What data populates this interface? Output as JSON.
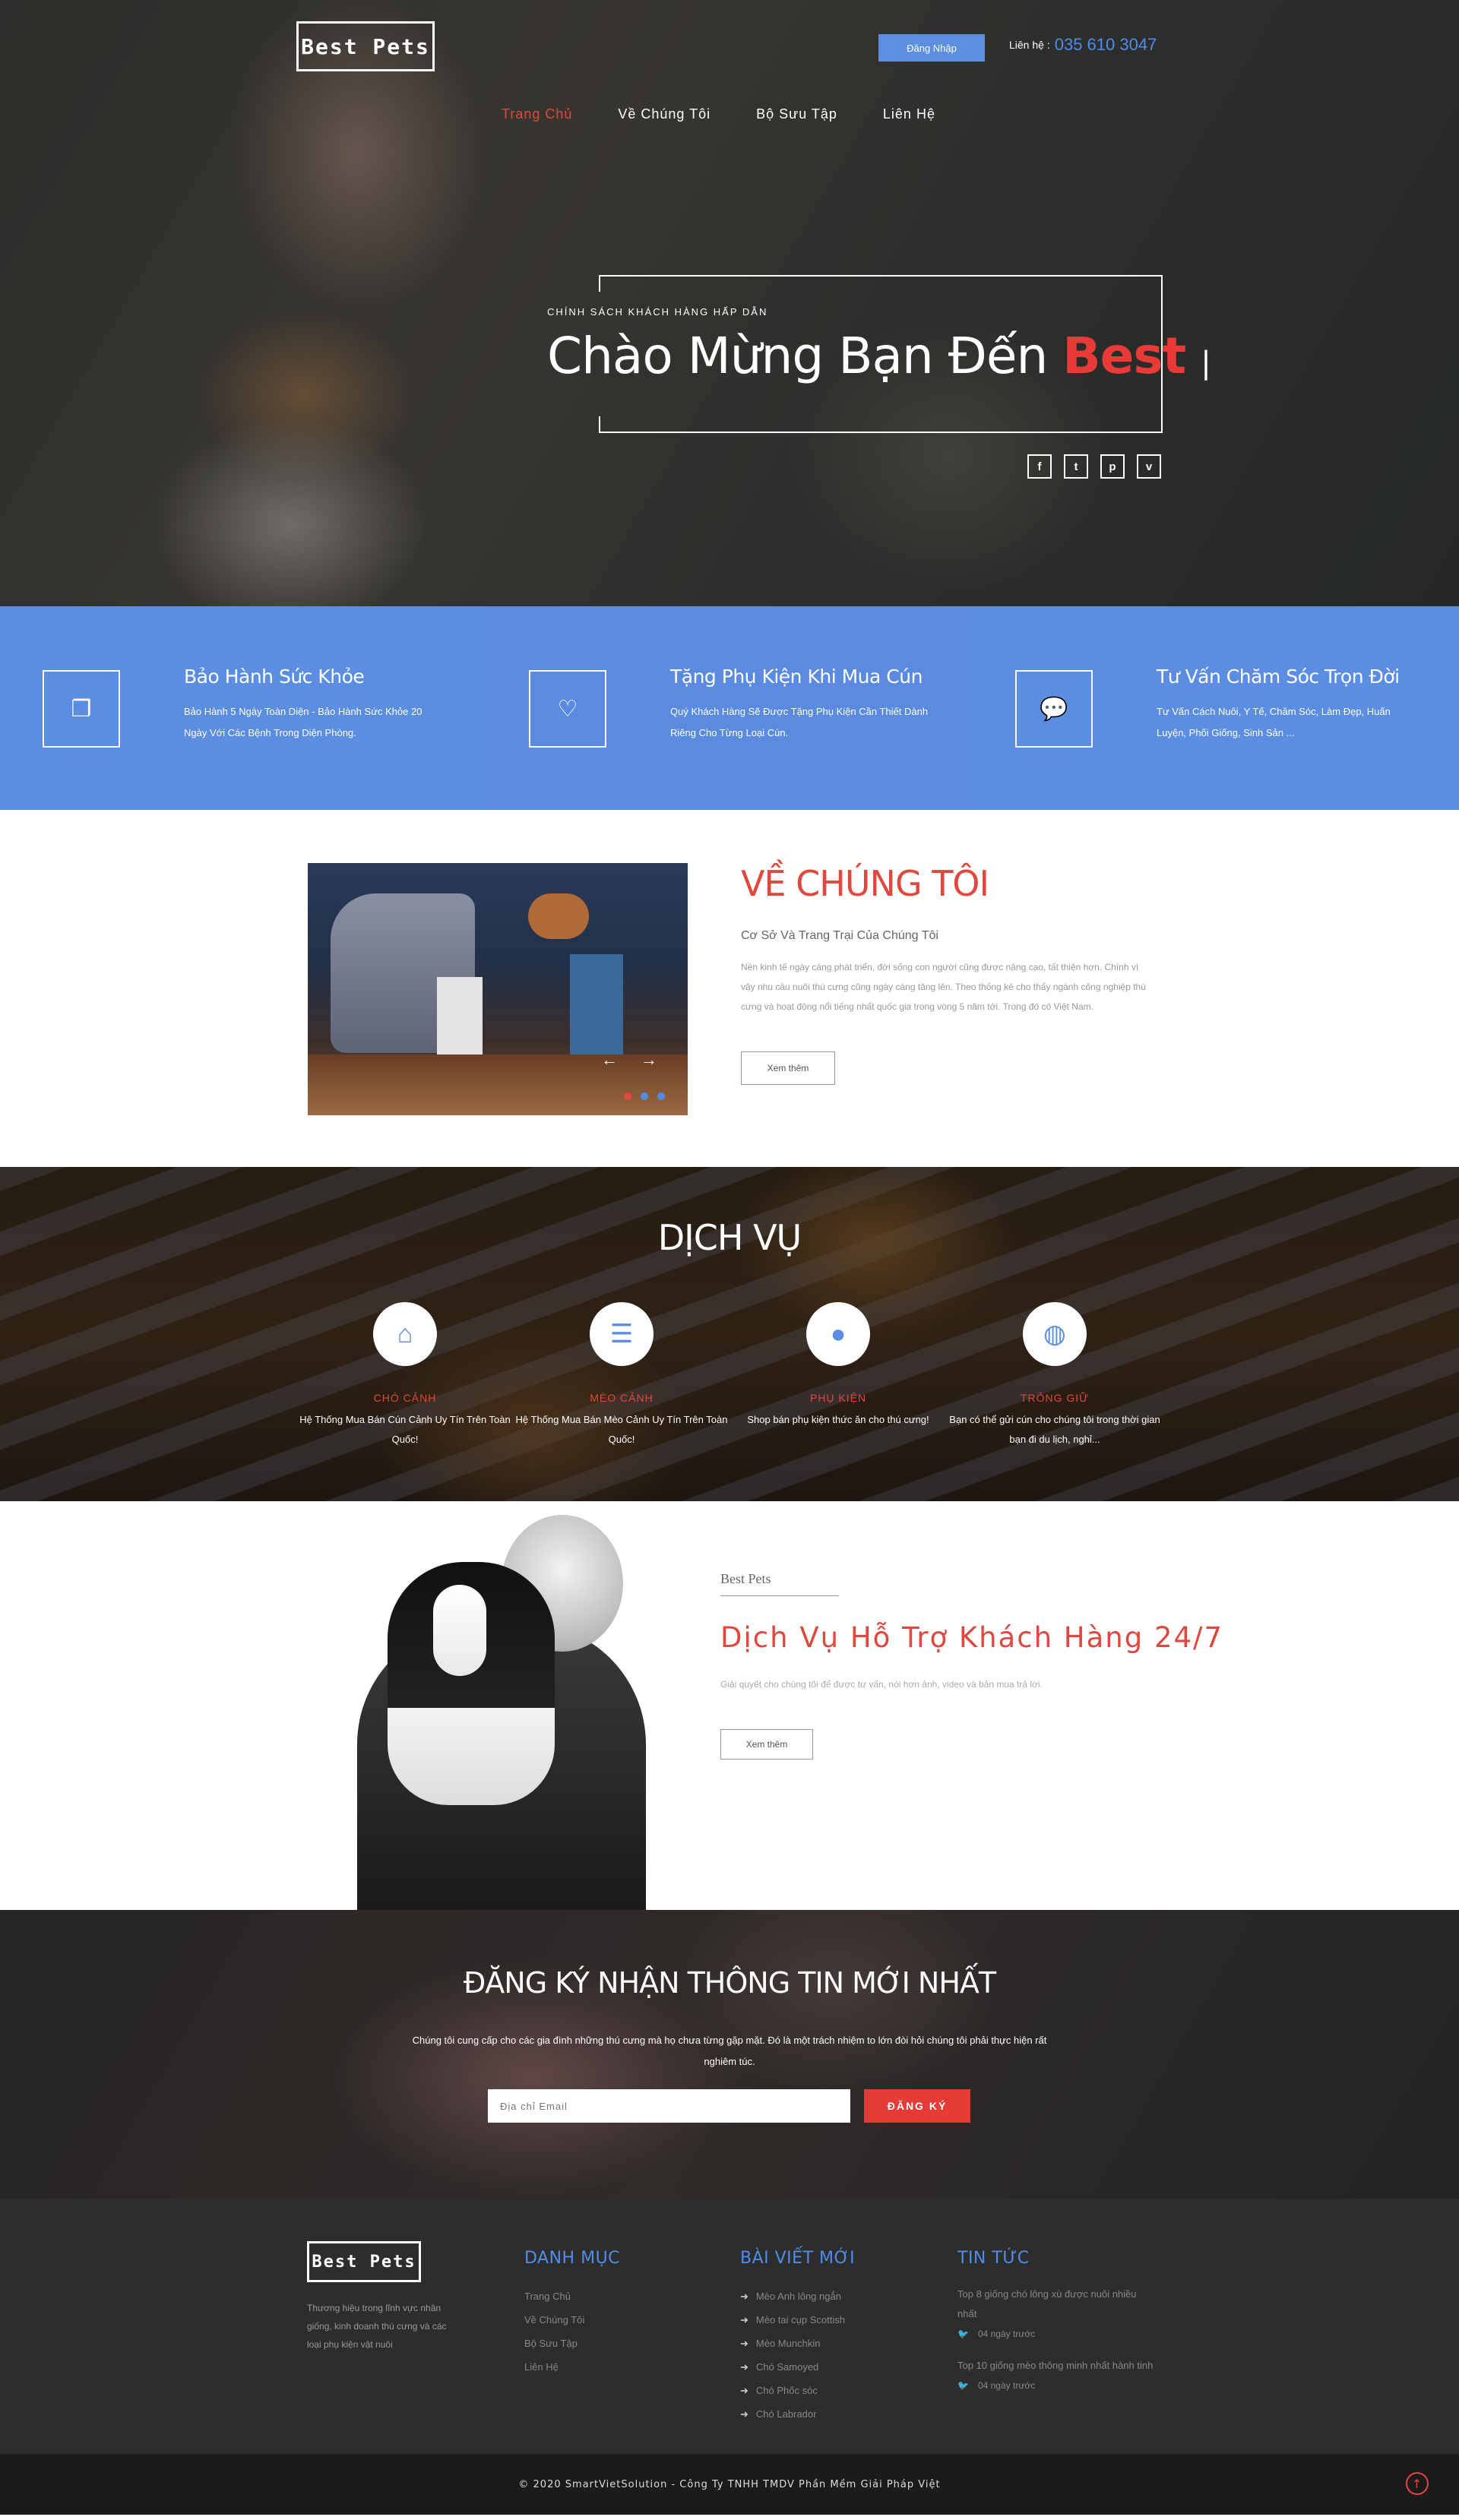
{
  "header": {
    "logo": "Best Pets",
    "login_label": "Đăng Nhập",
    "contact_label": "Liên hệ :",
    "phone": "035 610 3047",
    "nav": [
      {
        "label": "Trang Chủ",
        "active": true
      },
      {
        "label": "Về Chúng Tôi",
        "active": false
      },
      {
        "label": "Bộ Sưu Tập",
        "active": false
      },
      {
        "label": "Liên Hệ",
        "active": false
      }
    ]
  },
  "hero": {
    "kicker": "CHÍNH SÁCH KHÁCH HÀNG HẤP DẪN",
    "title_prefix": "Chào Mừng Bạn Đến",
    "title_highlight": "Best",
    "cursor": "|",
    "social": [
      {
        "icon": "facebook-icon",
        "glyph": "f"
      },
      {
        "icon": "twitter-icon",
        "glyph": "t"
      },
      {
        "icon": "pinterest-icon",
        "glyph": "p"
      },
      {
        "icon": "vimeo-icon",
        "glyph": "v"
      }
    ]
  },
  "features": [
    {
      "icon": "copy-icon",
      "glyph": "❐",
      "title": "Bảo Hành Sức Khỏe",
      "text": "Bảo Hành 5 Ngày Toàn Diện - Bảo Hành Sức Khỏe 20 Ngày Với Các Bệnh Trong Diện Phòng."
    },
    {
      "icon": "heart-icon",
      "glyph": "♡",
      "title": "Tặng Phụ Kiện Khi Mua Cún",
      "text": "Quý Khách Hàng Sẽ Được Tặng Phụ Kiện Cần Thiết Dành Riêng Cho Từng Loại Cún."
    },
    {
      "icon": "chat-icon",
      "glyph": "💬",
      "title": "Tư Vấn Chăm Sóc Trọn Đời",
      "text": "Tư Vấn Cách Nuôi, Y Tế, Chăm Sóc, Làm Đẹp, Huấn Luyện, Phối Giống, Sinh Sản ..."
    }
  ],
  "about": {
    "title": "VỀ CHÚNG TÔI",
    "subtitle": "Cơ Sở Và Trang Trại Của Chúng Tôi",
    "text": "Nền kinh tế ngày càng phát triển, đời sống con người cũng được nâng cao, tất thiện hơn. Chính vì vậy nhu cầu nuôi thú cưng cũng ngày càng tăng lên. Theo thống kê cho thấy ngành công nghiệp thú cưng và hoạt động nổi tiếng nhất quốc gia trong vòng 5 năm tới. Trong đó có Việt Nam.",
    "button": "Xem thêm"
  },
  "services": {
    "title": "DỊCH VỤ",
    "items": [
      {
        "icon": "home-icon",
        "glyph": "⌂",
        "title": "CHÓ CẢNH",
        "text": "Hệ Thống Mua Bán Cún Cảnh Uy Tín Trên Toàn Quốc!"
      },
      {
        "icon": "list-icon",
        "glyph": "☰",
        "title": "MÈO CẢNH",
        "text": "Hệ Thống Mua Bán Mèo Cảnh Uy Tín Trên Toàn Quốc!"
      },
      {
        "icon": "bulb-icon",
        "glyph": "●",
        "title": "PHỤ KIỆN",
        "text": "Shop bán phụ kiện thức ăn cho thú cưng!"
      },
      {
        "icon": "globe-icon",
        "glyph": "◍",
        "title": "TRÔNG GIỮ",
        "text": "Bạn có thể gửi cún cho chúng tôi trong thời gian bạn đi du lịch, nghỉ..."
      }
    ]
  },
  "support": {
    "brand": "Best Pets",
    "title": "Dịch Vụ Hỗ Trợ Khách Hàng 24/7",
    "text": "Giải quyết cho chúng tôi để được tư vấn, nói hơn ảnh, video và bản mua trả lời.",
    "button": "Xem thêm"
  },
  "newsletter": {
    "title": "ĐĂNG KÝ NHẬN THÔNG TIN MỚI NHẤT",
    "text": "Chúng tôi cung cấp cho các gia đình những thú cưng mà họ chưa từng gặp mặt. Đó là một trách nhiệm to lớn đòi hỏi chúng tôi phải thực hiện rất nghiêm túc.",
    "placeholder": "Địa chỉ Email",
    "button": "ĐĂNG KÝ"
  },
  "footer": {
    "logo": "Best Pets",
    "about": "Thương hiệu trong lĩnh vực nhân giống, kinh doanh thú cưng và các loại phụ kiện vật nuôi",
    "categories_title": "DANH MỤC",
    "categories": [
      "Trang Chủ",
      "Về Chúng Tôi",
      "Bộ Sưu Tập",
      "Liên Hệ"
    ],
    "posts_title": "BÀI VIẾT MỚI",
    "posts": [
      "Mèo Anh lông ngắn",
      "Mèo tai cụp Scottish",
      "Mèo Munchkin",
      "Chó Samoyed",
      "Chó Phốc sóc",
      "Chó Labrador"
    ],
    "news_title": "TIN TỨC",
    "news": [
      {
        "title": "Top 8 giống chó lông xù được nuôi nhiều nhất",
        "time": "04 ngày trước"
      },
      {
        "title": "Top 10 giống mèo thông minh nhất hành tinh",
        "time": "04 ngày trước"
      }
    ]
  },
  "copyright": "© 2020 SmartVietSolution - Công Ty TNHH TMDV Phần Mềm Giải Pháp Việt",
  "colors": {
    "accent_red": "#e0483e",
    "accent_blue": "#5b8ee3"
  }
}
